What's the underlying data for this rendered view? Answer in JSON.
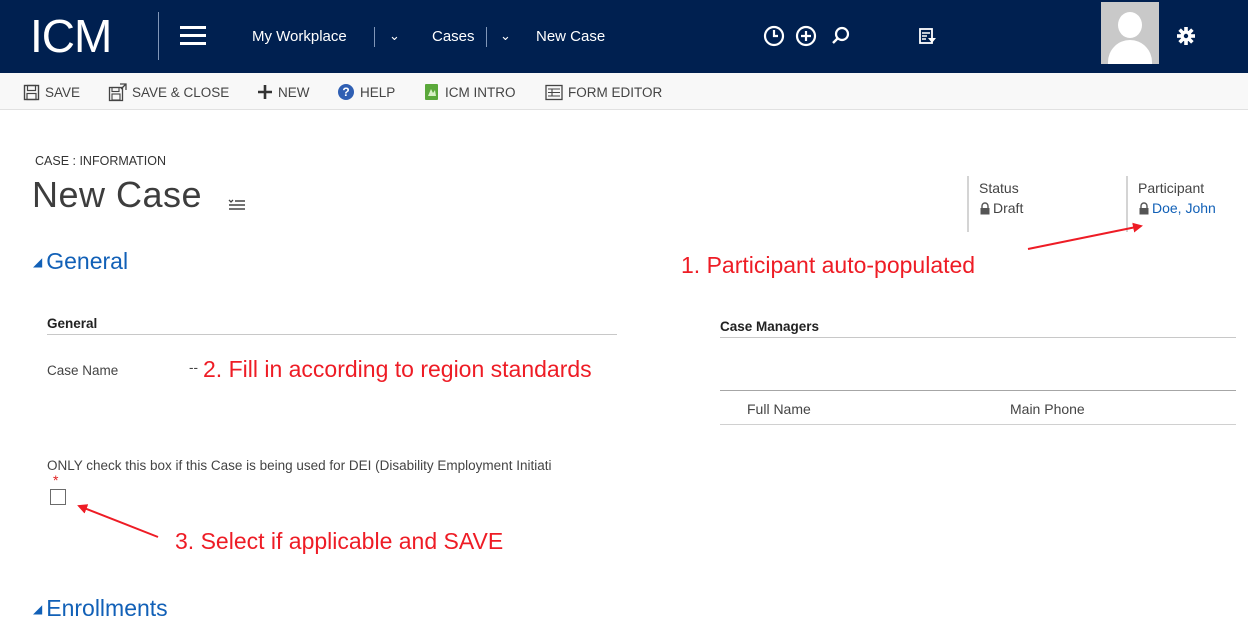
{
  "app": {
    "logo": "ICM"
  },
  "nav": {
    "items": [
      {
        "label": "My Workplace"
      },
      {
        "label": "Cases"
      },
      {
        "label": "New Case"
      }
    ]
  },
  "topbar_icons": [
    "history-icon",
    "quick-create-icon",
    "search-icon",
    "advanced-find-icon",
    "user-avatar",
    "settings-icon"
  ],
  "commands": {
    "save": "SAVE",
    "save_close": "SAVE & CLOSE",
    "new": "NEW",
    "help": "HELP",
    "icm_intro": "ICM INTRO",
    "form_editor": "FORM EDITOR"
  },
  "form": {
    "entity_label": "CASE : INFORMATION",
    "title": "New Case",
    "header_fields": {
      "status": {
        "label": "Status",
        "value": "Draft"
      },
      "participant": {
        "label": "Participant",
        "value": "Doe, John"
      }
    }
  },
  "sections": {
    "general": {
      "title": "General",
      "subsection_title": "General",
      "case_name": {
        "label": "Case Name",
        "value": "--"
      },
      "dei_checkbox": {
        "label": "ONLY check this box if this Case is being used for DEI (Disability Employment Initiati",
        "required_marker": "*",
        "checked": false
      },
      "case_managers": {
        "title": "Case Managers",
        "columns": [
          "Full Name",
          "Main Phone"
        ]
      }
    },
    "enrollments": {
      "title": "Enrollments"
    }
  },
  "annotations": {
    "a1": "1. Participant auto-populated",
    "a2": "2. Fill in according to region standards",
    "a3": "3. Select if applicable and SAVE"
  },
  "colors": {
    "nav_bg": "#002050",
    "link_blue": "#1160b7",
    "annotation_red": "#ee1c25"
  }
}
